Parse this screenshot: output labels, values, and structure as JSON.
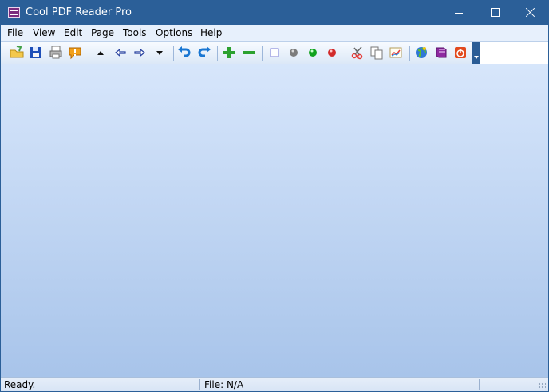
{
  "window": {
    "title": "Cool PDF Reader Pro",
    "controls": {
      "minimize_icon": "minimize-icon",
      "maximize_icon": "maximize-icon",
      "close_icon": "close-icon"
    }
  },
  "menubar": {
    "items": [
      {
        "label": "File"
      },
      {
        "label": "View"
      },
      {
        "label": "Edit"
      },
      {
        "label": "Page"
      },
      {
        "label": "Tools"
      },
      {
        "label": "Options"
      },
      {
        "label": "Help"
      }
    ]
  },
  "toolbar": {
    "buttons": [
      {
        "icon": "open-folder-icon"
      },
      {
        "icon": "save-icon"
      },
      {
        "icon": "print-icon"
      },
      {
        "icon": "info-warning-icon"
      },
      {
        "icon": "page-up-icon"
      },
      {
        "icon": "back-arrow-icon"
      },
      {
        "icon": "forward-arrow-icon"
      },
      {
        "icon": "page-down-icon"
      },
      {
        "icon": "undo-icon"
      },
      {
        "icon": "redo-icon"
      },
      {
        "icon": "zoom-in-icon"
      },
      {
        "icon": "zoom-out-icon"
      },
      {
        "icon": "square-icon"
      },
      {
        "icon": "gray-dot-icon"
      },
      {
        "icon": "green-dot-icon"
      },
      {
        "icon": "red-dot-icon"
      },
      {
        "icon": "cut-icon"
      },
      {
        "icon": "copy-icon"
      },
      {
        "icon": "chart-image-icon"
      },
      {
        "icon": "globe-icon"
      },
      {
        "icon": "book-icon"
      },
      {
        "icon": "power-icon"
      }
    ]
  },
  "statusbar": {
    "status": "Ready.",
    "file_info": "File: N/A"
  },
  "colors": {
    "titlebar": "#2b5f98",
    "menubar": "#e7f0fc",
    "content_top": "#d7e6fb",
    "content_bottom": "#a8c4ea"
  }
}
